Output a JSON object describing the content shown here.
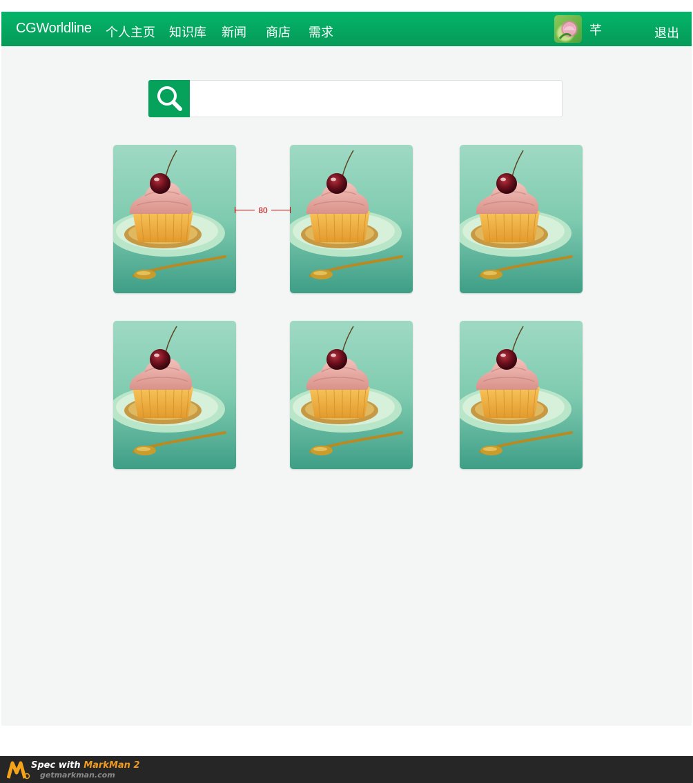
{
  "nav": {
    "brand": "CGWorldline",
    "items": [
      {
        "label": "个人主页"
      },
      {
        "label": "知识库"
      },
      {
        "label": "新闻"
      },
      {
        "label": "商店"
      },
      {
        "label": "需求"
      }
    ],
    "username": "芊",
    "logout": "退出",
    "avatar_icon": "avatar-flower-icon"
  },
  "search": {
    "icon": "search-icon",
    "placeholder": "",
    "value": ""
  },
  "gallery": {
    "items": [
      {
        "image": "cupcake-cherry-image"
      },
      {
        "image": "cupcake-cherry-image"
      },
      {
        "image": "cupcake-cherry-image"
      },
      {
        "image": "cupcake-cherry-image"
      },
      {
        "image": "cupcake-cherry-image"
      },
      {
        "image": "cupcake-cherry-image"
      }
    ]
  },
  "annotation": {
    "spacing_label": "80"
  },
  "footer": {
    "line1_prefix": "Spec with ",
    "line1_product": "MarkMan 2",
    "line2": "getmarkman.com"
  },
  "colors": {
    "nav_green": "#04a860",
    "search_green": "#06a15a",
    "background": "#f4f6f5",
    "annotation_red": "#d00000",
    "footer_bg": "#262626",
    "footer_accent": "#f39a1c"
  }
}
